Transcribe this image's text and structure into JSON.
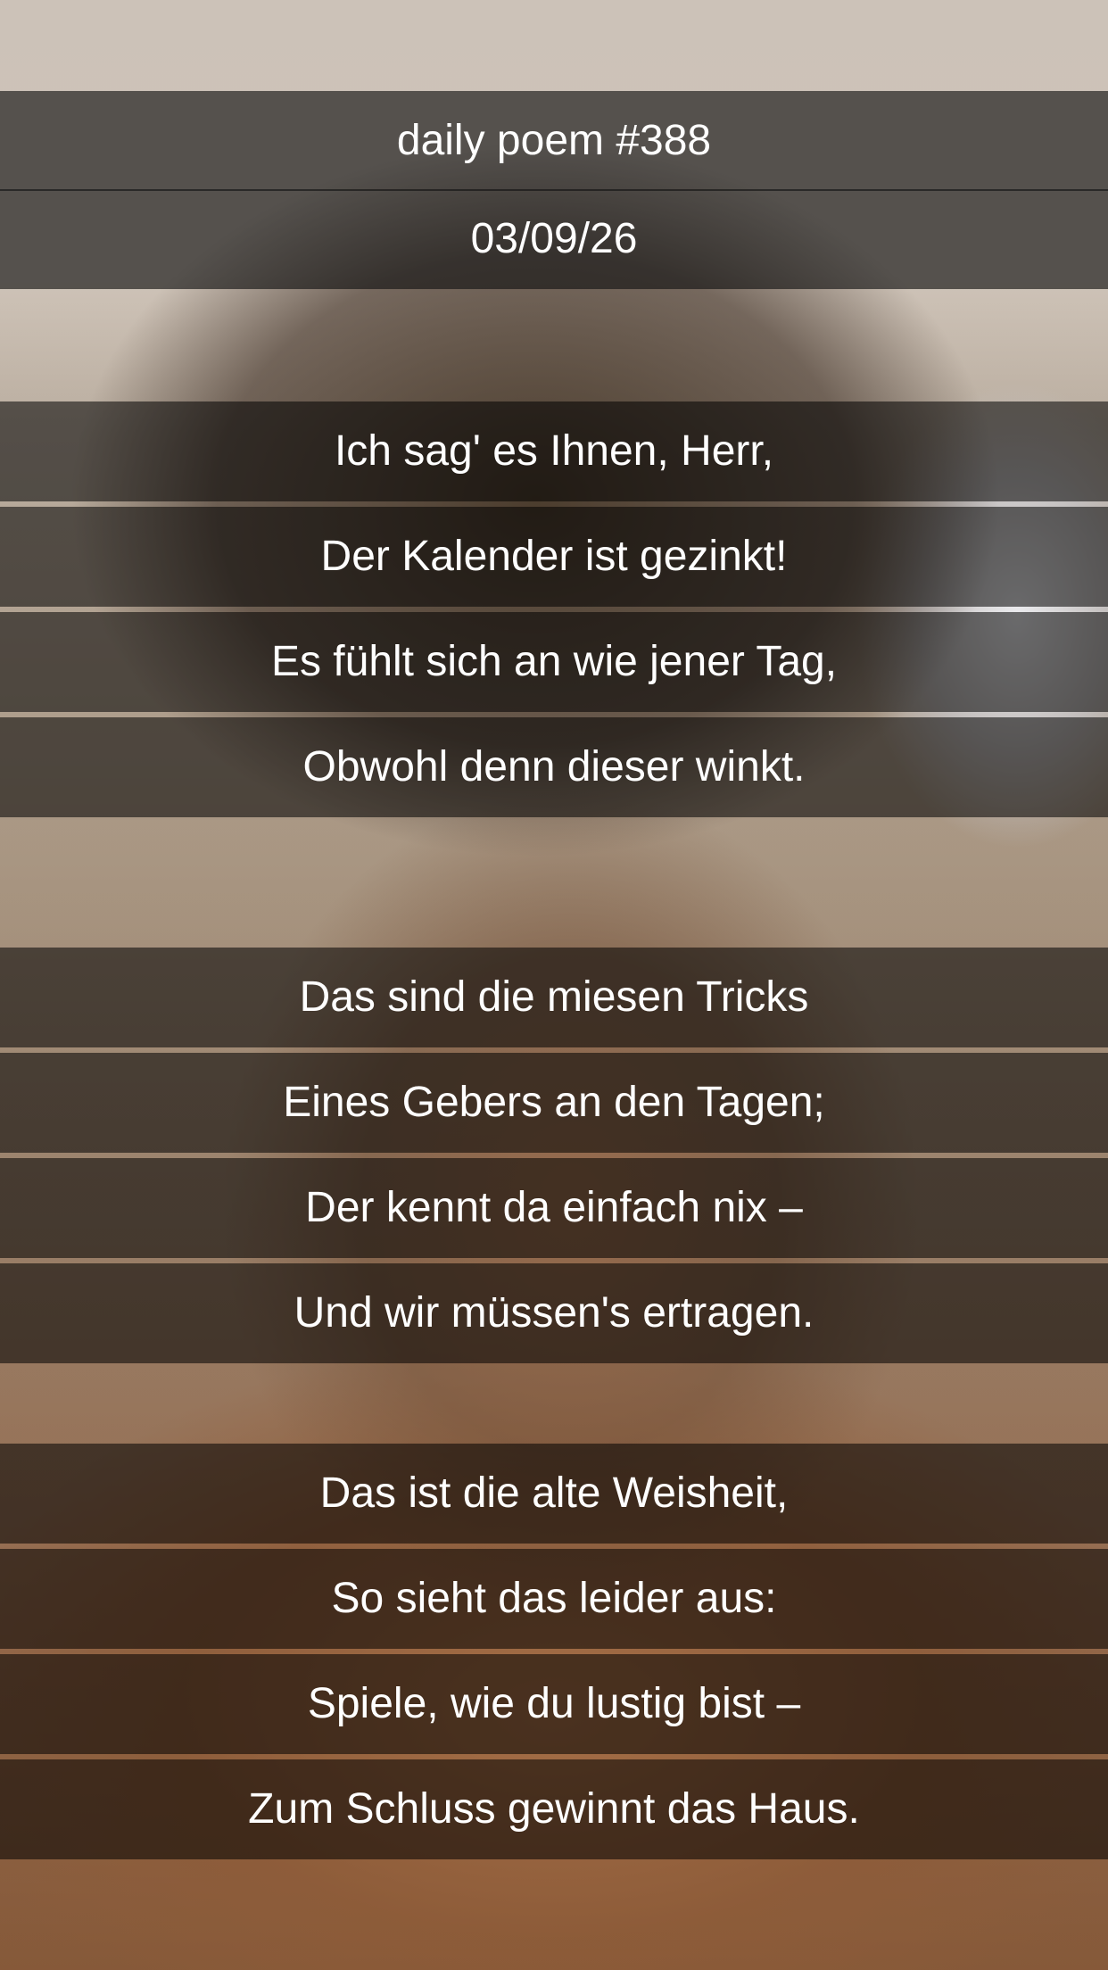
{
  "header": {
    "title": "daily poem #388",
    "date": "03/09/26"
  },
  "poem": {
    "stanzas": [
      {
        "lines": [
          "Ich sag' es Ihnen, Herr,",
          "Der Kalender ist gezinkt!",
          "Es fühlt sich an wie jener Tag,",
          "Obwohl denn dieser winkt."
        ]
      },
      {
        "lines": [
          "Das sind die miesen Tricks",
          "Eines Gebers an den Tagen;",
          "Der kennt da einfach nix –",
          "Und wir müssen's ertragen."
        ]
      },
      {
        "lines": [
          "Das ist die alte Weisheit,",
          "So sieht das leider aus:",
          "Spiele, wie du lustig bist –",
          "Zum Schluss gewinnt das Haus."
        ]
      }
    ]
  }
}
